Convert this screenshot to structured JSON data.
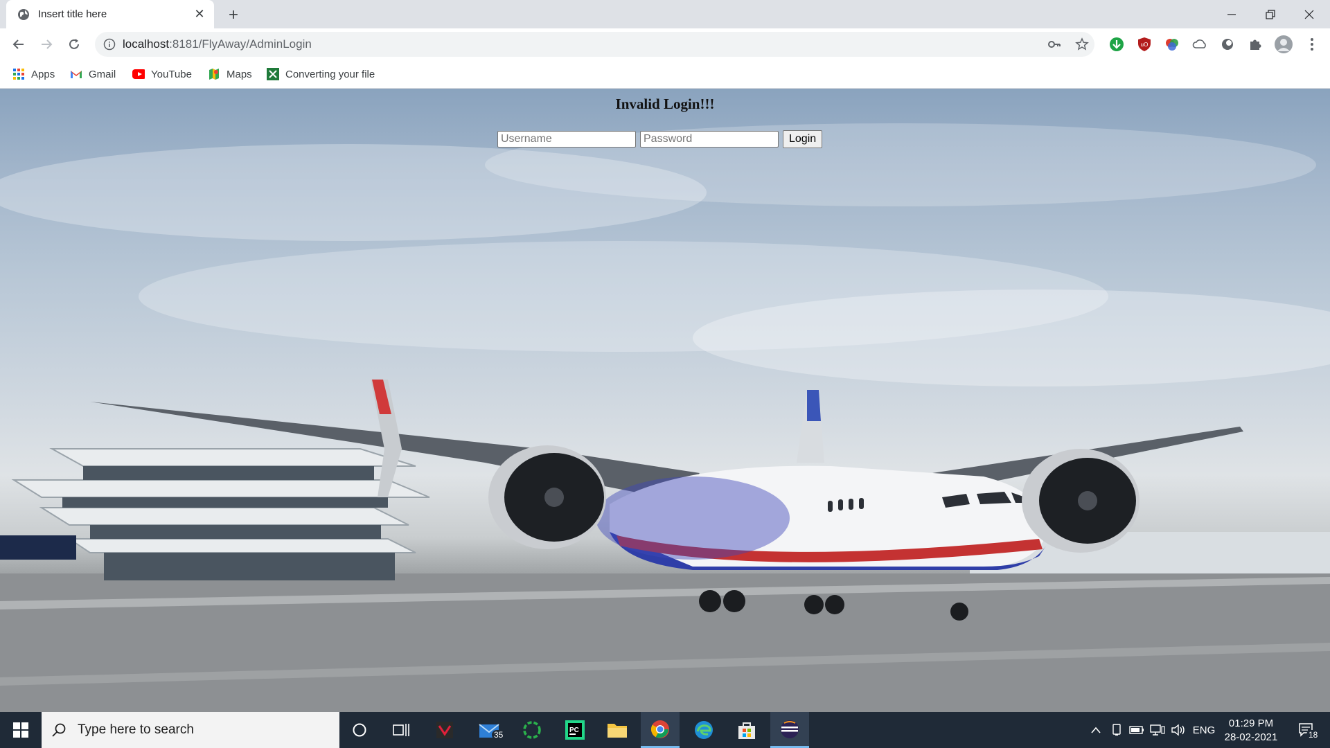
{
  "browser": {
    "tab": {
      "title": "Insert title here"
    },
    "address": {
      "host": "localhost",
      "path": ":8181/FlyAway/AdminLogin"
    },
    "bookmarks": [
      {
        "label": "Apps",
        "icon": "apps-grid-icon"
      },
      {
        "label": "Gmail",
        "icon": "gmail-icon"
      },
      {
        "label": "YouTube",
        "icon": "youtube-icon"
      },
      {
        "label": "Maps",
        "icon": "maps-icon"
      },
      {
        "label": "Converting your file",
        "icon": "file-convert-icon"
      }
    ]
  },
  "page": {
    "message": "Invalid Login!!!",
    "username_placeholder": "Username",
    "password_placeholder": "Password",
    "login_label": "Login"
  },
  "taskbar": {
    "search_placeholder": "Type here to search",
    "mail_badge": "35",
    "language": "ENG",
    "time": "01:29 PM",
    "date": "28-02-2021",
    "notification_count": "18"
  },
  "colors": {
    "tabstrip": "#dee1e6",
    "taskbar": "#1f2a37",
    "accent": "#76b9ed"
  }
}
